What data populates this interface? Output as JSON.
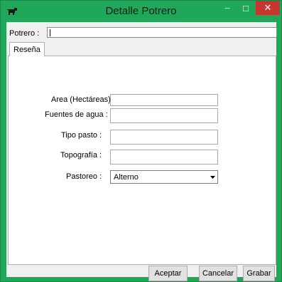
{
  "window": {
    "title": "Detalle Potrero",
    "minimize_glyph": "−",
    "maximize_glyph": "□",
    "close_glyph": "✕",
    "icon": "cow-icon"
  },
  "header": {
    "potrero_label": "Potrero :",
    "potrero_value": ""
  },
  "tabs": [
    {
      "label": "Reseña",
      "selected": true
    }
  ],
  "form": {
    "area_label": "Area (Hectáreas):",
    "area_value": "",
    "fuentes_label": "Fuentes de agua :",
    "fuentes_value": "",
    "tipo_pasto_label": "Tipo pasto :",
    "tipo_pasto_value": "",
    "topografia_label": "Topografía :",
    "topografia_value": "",
    "pastoreo_label": "Pastoreo :",
    "pastoreo_value": "Alterno"
  },
  "buttons": {
    "aceptar": "Aceptar",
    "cancelar": "Cancelar",
    "grabar": "Grabar"
  },
  "colors": {
    "titlebar": "#1fa85a",
    "close_button": "#c7372f",
    "dialog_background": "#f0f0f0"
  }
}
